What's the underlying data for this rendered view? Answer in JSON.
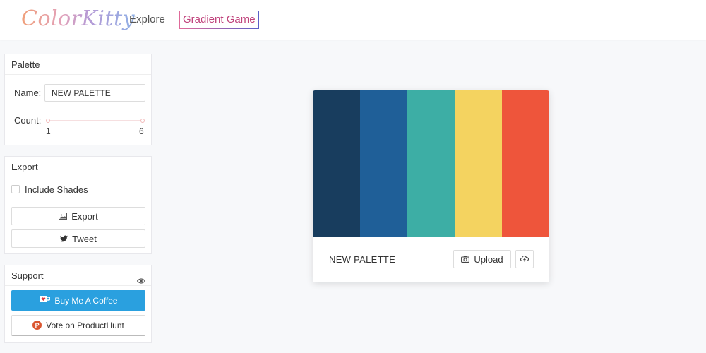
{
  "header": {
    "logo": "ColorKitty",
    "nav": {
      "explore": "Explore",
      "gradient_game": "Gradient Game"
    }
  },
  "palette_panel": {
    "title": "Palette",
    "name_label": "Name:",
    "name_value": "NEW PALETTE",
    "count_label": "Count:",
    "count_min": "1",
    "count_max": "6"
  },
  "export_panel": {
    "title": "Export",
    "include_shades_label": "Include Shades",
    "export_label": "Export",
    "tweet_label": "Tweet"
  },
  "support_panel": {
    "title": "Support",
    "coffee_label": "Buy Me A Coffee",
    "producthunt_label": "Vote on ProductHunt",
    "producthunt_logo_letter": "P"
  },
  "palette_card": {
    "name": "NEW PALETTE",
    "upload_label": "Upload",
    "colors": [
      "#183d5e",
      "#1f5f98",
      "#3daea5",
      "#f4d360",
      "#ee553b"
    ]
  },
  "colors": {
    "coffee_blue": "#2aa0df",
    "producthunt_orange": "#da552f",
    "gradient_game_text": "#c0437c"
  }
}
